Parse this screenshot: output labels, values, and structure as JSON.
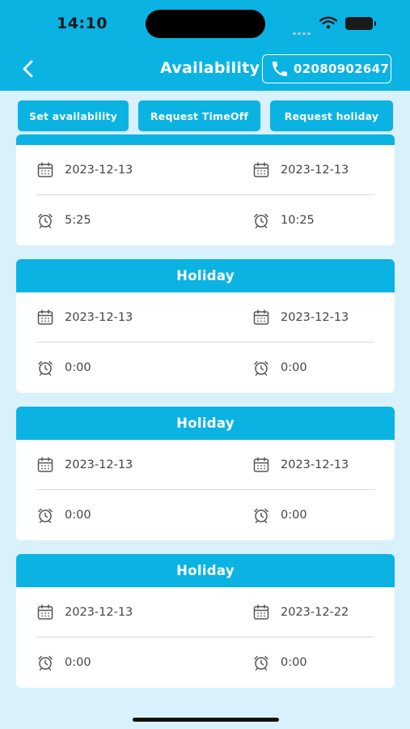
{
  "status_bar": {
    "time": "14:10"
  },
  "nav": {
    "title": "Availability",
    "phone": "02080902647",
    "back_icon": "chevron-left-icon",
    "phone_icon": "phone-icon"
  },
  "actions": {
    "set_availability": "Set availability",
    "request_timeoff": "Request TimeOff",
    "request_holiday": "Request holiday"
  },
  "colors": {
    "primary": "#0bb3e3",
    "background": "#d8f1fa",
    "card": "#ffffff",
    "text": "#444444"
  },
  "cards": [
    {
      "title": "",
      "start_date": "2023-12-13",
      "end_date": "2023-12-13",
      "start_time": "5:25",
      "end_time": "10:25"
    },
    {
      "title": "Holiday",
      "start_date": "2023-12-13",
      "end_date": "2023-12-13",
      "start_time": "0:00",
      "end_time": "0:00"
    },
    {
      "title": "Holiday",
      "start_date": "2023-12-13",
      "end_date": "2023-12-13",
      "start_time": "0:00",
      "end_time": "0:00"
    },
    {
      "title": "Holiday",
      "start_date": "2023-12-13",
      "end_date": "2023-12-22",
      "start_time": "0:00",
      "end_time": "0:00"
    }
  ]
}
